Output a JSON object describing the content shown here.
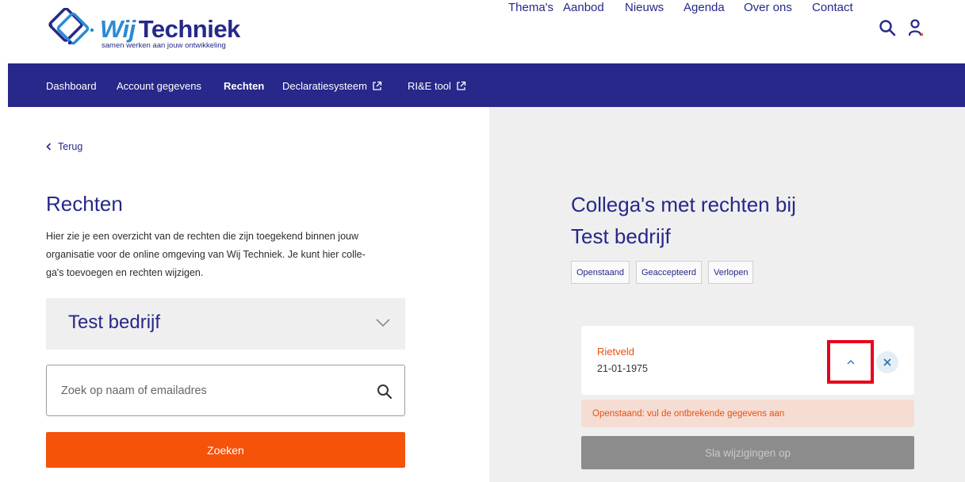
{
  "header": {
    "logo": {
      "brand_prefix": "Wij",
      "brand_name": "Techniek",
      "tagline": "samen werken aan jouw ontwikkeling"
    },
    "nav": [
      {
        "label": "Thema's"
      },
      {
        "label": "Aanbod"
      },
      {
        "label": "Nieuws"
      },
      {
        "label": "Agenda"
      },
      {
        "label": "Over ons"
      },
      {
        "label": "Contact"
      }
    ],
    "icons": [
      "search-icon",
      "user-icon"
    ]
  },
  "subnav": {
    "items": [
      {
        "label": "Dashboard",
        "active": false,
        "external": false
      },
      {
        "label": "Account gegevens",
        "active": false,
        "external": false
      },
      {
        "label": "Rechten",
        "active": true,
        "external": false
      },
      {
        "label": "Declaratiesysteem",
        "active": false,
        "external": true
      },
      {
        "label": "RI&E tool",
        "active": false,
        "external": true
      }
    ]
  },
  "left": {
    "back_label": "Terug",
    "title": "Rechten",
    "description_lines": [
      "Hier zie je een overzicht van de rechten die zijn toegekend binnen jouw",
      "organisatie voor de online omgeving van Wij Techniek. Je kunt hier colle-",
      "ga's toevoegen en rechten wijzigen."
    ],
    "company_select": {
      "selected": "Test bedrijf"
    },
    "search": {
      "value": "",
      "placeholder": "Zoek op naam of emailadres"
    },
    "search_button_label": "Zoeken"
  },
  "right": {
    "title_lines": [
      "Collega's met rechten bij",
      "Test bedrijf"
    ],
    "filters": [
      {
        "label": "Openstaand"
      },
      {
        "label": "Geaccepteerd"
      },
      {
        "label": "Verlopen"
      }
    ],
    "colleague": {
      "name": "Rietveld",
      "date": "21-01-1975"
    },
    "warning": "Openstaand: vul de ontbrekende gegevens aan",
    "save_button_label": "Sla wijzigingen op"
  },
  "colors": {
    "brand_blue": "#26288a",
    "accent_orange": "#f5520a",
    "panel_gray": "#efefef",
    "warning_bg": "#f6ddd3",
    "highlight_red": "#e8001c"
  }
}
